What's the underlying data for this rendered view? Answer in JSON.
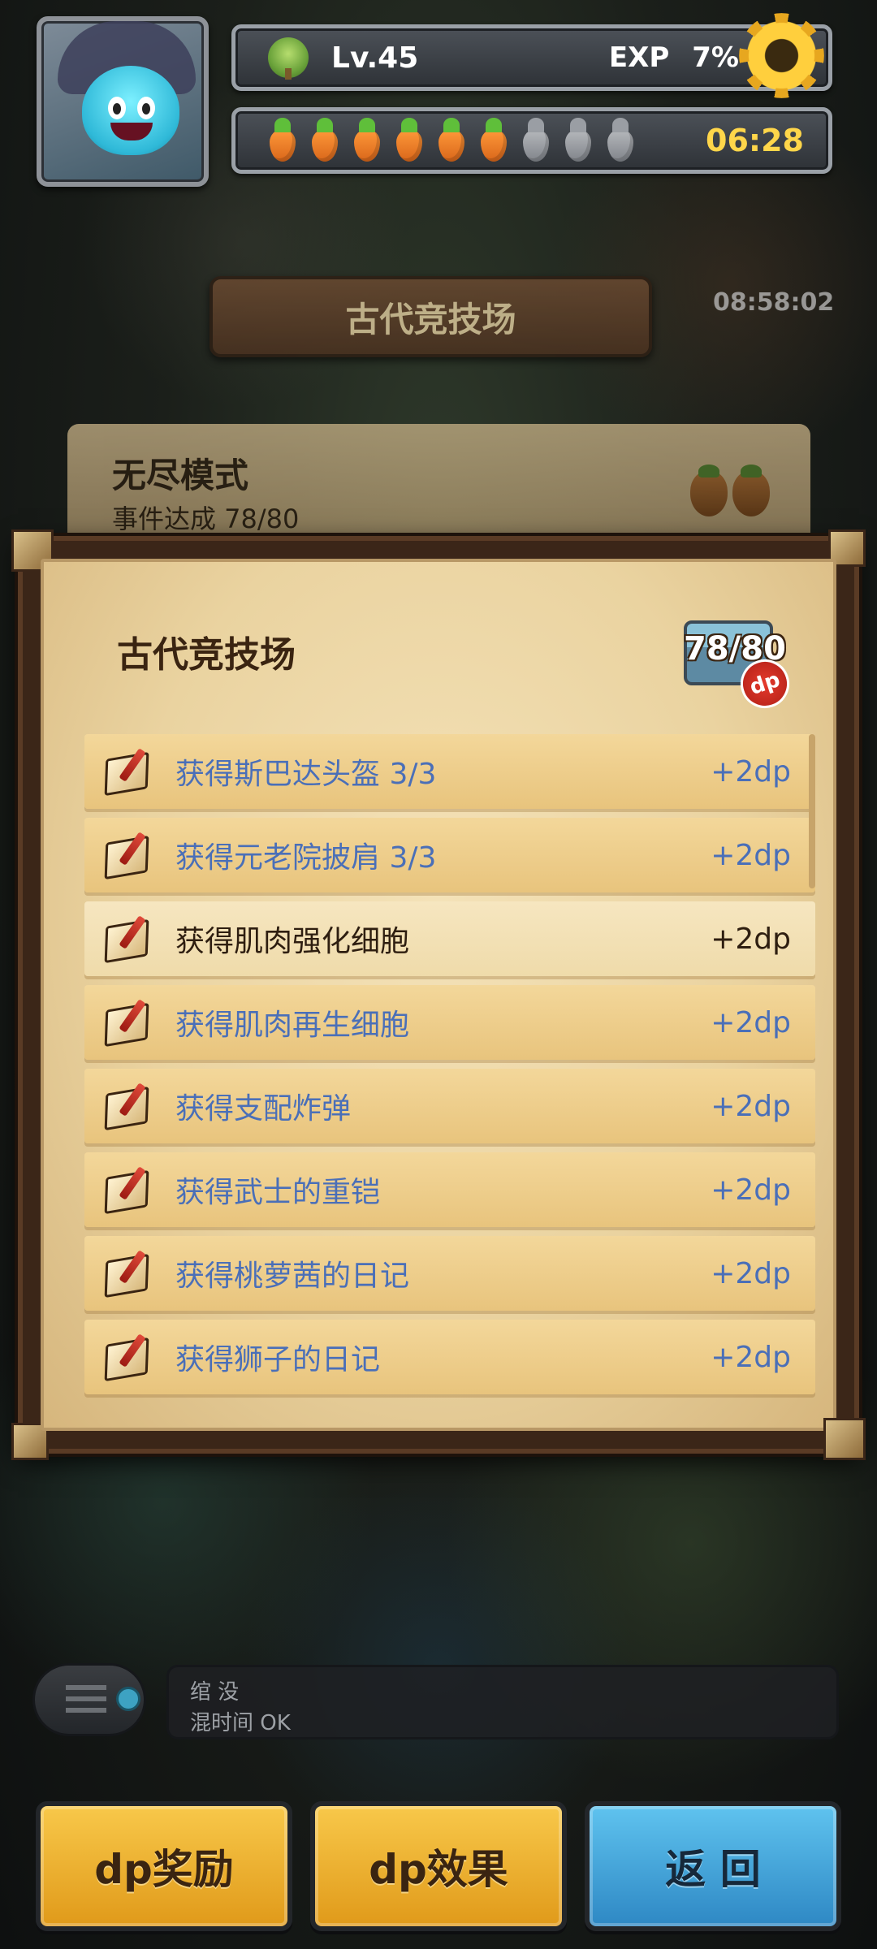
{
  "hud": {
    "level": "Lv.45",
    "exp_label": "EXP",
    "exp_value": "7%",
    "stamina_full": 6,
    "stamina_total": 9,
    "stamina_timer": "06:28"
  },
  "background": {
    "arena_title": "古代竞技场",
    "timer": "08:58:02",
    "endless_mode_title": "无尽模式",
    "endless_mode_progress": "事件达成 78/80"
  },
  "modal": {
    "title": "古代竞技场",
    "progress": "78/80",
    "badge": "dp",
    "items": [
      {
        "text": "获得斯巴达头盔 3/3",
        "points": "+2dp",
        "completed": true
      },
      {
        "text": "获得元老院披肩 3/3",
        "points": "+2dp",
        "completed": true
      },
      {
        "text": "获得肌肉强化细胞",
        "points": "+2dp",
        "completed": false
      },
      {
        "text": "获得肌肉再生细胞",
        "points": "+2dp",
        "completed": true
      },
      {
        "text": "获得支配炸弹",
        "points": "+2dp",
        "completed": true
      },
      {
        "text": "获得武士的重铠",
        "points": "+2dp",
        "completed": true
      },
      {
        "text": "获得桃萝茜的日记",
        "points": "+2dp",
        "completed": true
      },
      {
        "text": "获得狮子的日记",
        "points": "+2dp",
        "completed": true
      }
    ]
  },
  "chat": {
    "line1": "绾 没",
    "line2": "混时间 OK"
  },
  "buttons": {
    "dp_reward": "dp奖励",
    "dp_effect": "dp效果",
    "back": "返 回"
  }
}
